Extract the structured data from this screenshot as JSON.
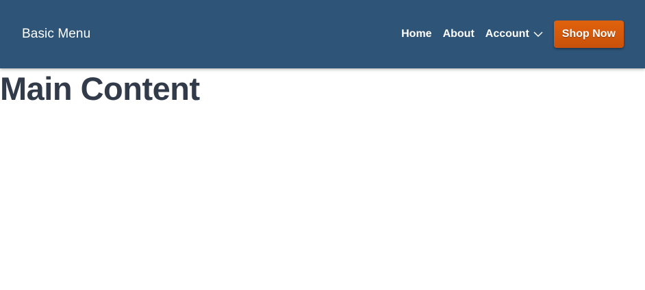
{
  "navbar": {
    "brand": "Basic Menu",
    "links": [
      {
        "label": "Home"
      },
      {
        "label": "About"
      },
      {
        "label": "Account",
        "icon": "chevron-down-icon"
      }
    ],
    "cta_label": "Shop Now",
    "colors": {
      "background": "#2e5478",
      "cta": "#d85a0c",
      "text": "#ffffff"
    }
  },
  "main": {
    "title": "Main Content",
    "title_color": "#323b49"
  }
}
